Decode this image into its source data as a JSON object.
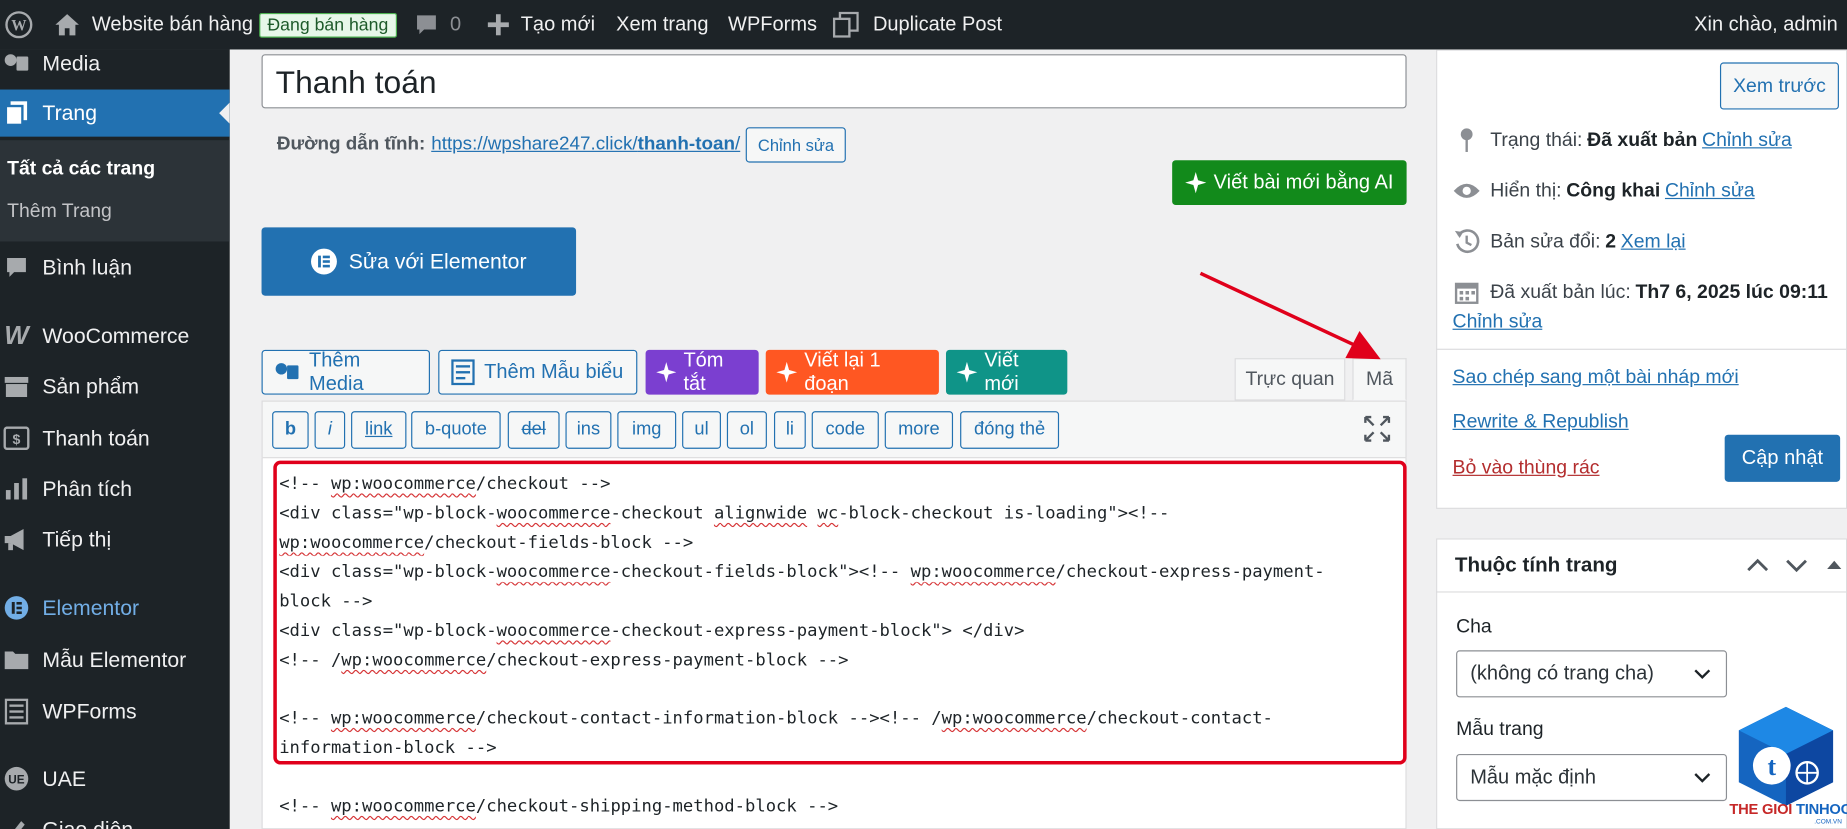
{
  "admin_bar": {
    "site_name": "Website bán hàng",
    "status_badge": "Đang bán hàng",
    "comments_count": "0",
    "new_label": "Tạo mới",
    "view_label": "Xem trang",
    "wpforms_label": "WPForms",
    "duplicate_label": "Duplicate Post",
    "greeting": "Xin chào, admin"
  },
  "sidebar": {
    "items": [
      {
        "label": "Media",
        "icon": "media-icon"
      },
      {
        "label": "Trang",
        "icon": "pages-icon"
      },
      {
        "label": "Bình luận",
        "icon": "comments-icon"
      },
      {
        "label": "WooCommerce",
        "icon": "woocommerce-icon"
      },
      {
        "label": "Sản phẩm",
        "icon": "products-icon"
      },
      {
        "label": "Thanh toán",
        "icon": "payments-icon"
      },
      {
        "label": "Phân tích",
        "icon": "analytics-icon"
      },
      {
        "label": "Tiếp thị",
        "icon": "marketing-icon"
      },
      {
        "label": "Elementor",
        "icon": "elementor-icon"
      },
      {
        "label": "Mẫu Elementor",
        "icon": "templates-icon"
      },
      {
        "label": "WPForms",
        "icon": "wpforms-icon"
      },
      {
        "label": "UAE",
        "icon": "uae-icon"
      },
      {
        "label": "Giao diện",
        "icon": "appearance-icon"
      }
    ],
    "submenu": [
      "Tất cả các trang",
      "Thêm Trang"
    ]
  },
  "editor": {
    "title": "Thanh toán",
    "permalink_label": "Đường dẫn tĩnh:",
    "permalink_base": "https://wpshare247.click/",
    "permalink_slug": "thanh-toan",
    "permalink_trail": "/",
    "permalink_edit": "Chỉnh sửa",
    "ai_write_new": "Viết bài mới bằng AI",
    "elementor_edit": "Sửa với Elementor",
    "add_media": "Thêm Media",
    "add_template": "Thêm Mẫu biểu",
    "ai_summary": "Tóm tắt",
    "ai_rewrite": "Viết lại 1 đoạn",
    "ai_new": "Viết mới",
    "tab_visual": "Trực quan",
    "tab_code": "Mã",
    "quicktags": [
      "b",
      "i",
      "link",
      "b-quote",
      "del",
      "ins",
      "img",
      "ul",
      "ol",
      "li",
      "code",
      "more",
      "đóng thẻ"
    ],
    "code_lines": [
      "<!-- wp:woocommerce/checkout -->",
      "<div class=\"wp-block-woocommerce-checkout alignwide wc-block-checkout is-loading\"><!--",
      "wp:woocommerce/checkout-fields-block -->",
      "<div class=\"wp-block-woocommerce-checkout-fields-block\"><!-- wp:woocommerce/checkout-express-payment-",
      "block -->",
      "<div class=\"wp-block-woocommerce-checkout-express-payment-block\"> </div>",
      "<!-- /wp:woocommerce/checkout-express-payment-block -->",
      "",
      "<!-- wp:woocommerce/checkout-contact-information-block --><!-- /wp:woocommerce/checkout-contact-",
      "information-block -->",
      "",
      "<!-- wp:woocommerce/checkout-shipping-method-block -->"
    ]
  },
  "publish": {
    "preview": "Xem trước",
    "status_label": "Trạng thái:",
    "status_value": "Đã xuất bản",
    "visibility_label": "Hiển thị:",
    "visibility_value": "Công khai",
    "revisions_label": "Bản sửa đổi:",
    "revisions_value": "2",
    "revisions_link": "Xem lại",
    "published_label": "Đã xuất bản lúc:",
    "published_value": "Th7 6, 2025 lúc 09:11",
    "edit_link": "Chỉnh sửa",
    "copy_draft": "Sao chép sang một bài nháp mới",
    "rewrite": "Rewrite & Republish",
    "trash": "Bỏ vào thùng rác",
    "update": "Cập nhật"
  },
  "attributes": {
    "title": "Thuộc tính trang",
    "parent_label": "Cha",
    "parent_value": "(không có trang cha)",
    "template_label": "Mẫu trang",
    "template_value": "Mẫu mặc định"
  },
  "watermark": {
    "brand_main": "THE GIOI ",
    "brand_accent": "TINHOC",
    "brand_domain": ".COM.VN"
  },
  "colors": {
    "admin_dark": "#1d2327",
    "primary": "#2271b1",
    "ai_green": "#128a1b",
    "ai_purple": "#7b3fd0",
    "ai_orange": "#ff5722",
    "ai_teal": "#0f9488",
    "annotation_red": "#e0001b"
  }
}
